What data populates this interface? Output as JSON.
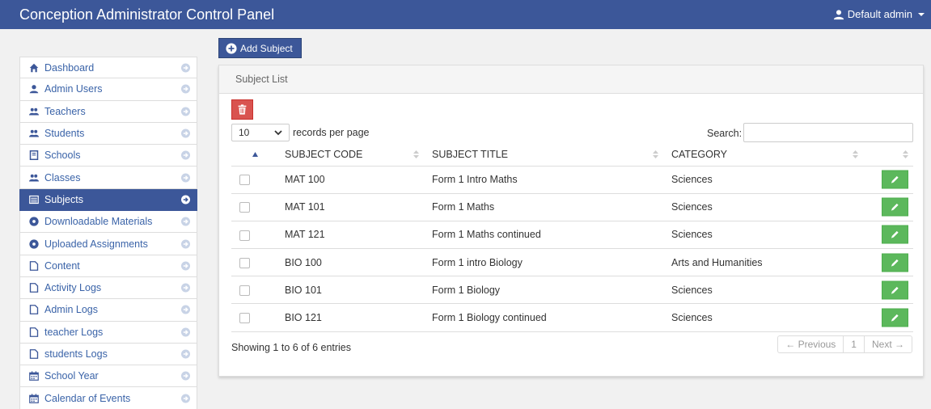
{
  "navbar": {
    "title": "Conception Administrator Control Panel",
    "user_label": "Default admin"
  },
  "sidebar": {
    "items": [
      {
        "label": "Dashboard",
        "icon": "home-icon"
      },
      {
        "label": "Admin Users",
        "icon": "user-icon"
      },
      {
        "label": "Teachers",
        "icon": "users-icon"
      },
      {
        "label": "Students",
        "icon": "users-icon"
      },
      {
        "label": "Schools",
        "icon": "school-icon"
      },
      {
        "label": "Classes",
        "icon": "users-icon"
      },
      {
        "label": "Subjects",
        "icon": "list-icon",
        "active": true
      },
      {
        "label": "Downloadable Materials",
        "icon": "download-circle-icon"
      },
      {
        "label": "Uploaded Assignments",
        "icon": "upload-circle-icon"
      },
      {
        "label": "Content",
        "icon": "file-icon"
      },
      {
        "label": "Activity Logs",
        "icon": "file-icon"
      },
      {
        "label": "Admin Logs",
        "icon": "file-icon"
      },
      {
        "label": "teacher Logs",
        "icon": "file-icon"
      },
      {
        "label": "students Logs",
        "icon": "file-icon"
      },
      {
        "label": "School Year",
        "icon": "calendar-icon"
      },
      {
        "label": "Calendar of Events",
        "icon": "calendar-icon"
      }
    ]
  },
  "toolbar": {
    "add_label": "Add Subject"
  },
  "panel": {
    "heading": "Subject List",
    "length_value": "10",
    "length_suffix": "records per page",
    "search_label": "Search:",
    "search_value": "",
    "info": "Showing 1 to 6 of 6 entries"
  },
  "table": {
    "columns": [
      "SUBJECT CODE",
      "SUBJECT TITLE",
      "CATEGORY"
    ],
    "rows": [
      {
        "code": "MAT 100",
        "title": "Form 1 Intro Maths",
        "category": "Sciences"
      },
      {
        "code": "MAT 101",
        "title": "Form 1 Maths",
        "category": "Sciences"
      },
      {
        "code": "MAT 121",
        "title": "Form 1 Maths continued",
        "category": "Sciences"
      },
      {
        "code": "BIO 100",
        "title": "Form 1 intro Biology",
        "category": "Arts and Humanities"
      },
      {
        "code": "BIO 101",
        "title": "Form 1 Biology",
        "category": "Sciences"
      },
      {
        "code": "BIO 121",
        "title": "Form 1 Biology continued",
        "category": "Sciences"
      }
    ]
  },
  "pagination": {
    "previous": "← Previous",
    "current": "1",
    "next": "Next →"
  },
  "colors": {
    "primary": "#3c5799",
    "danger": "#d9534f",
    "success": "#5cb85c"
  }
}
